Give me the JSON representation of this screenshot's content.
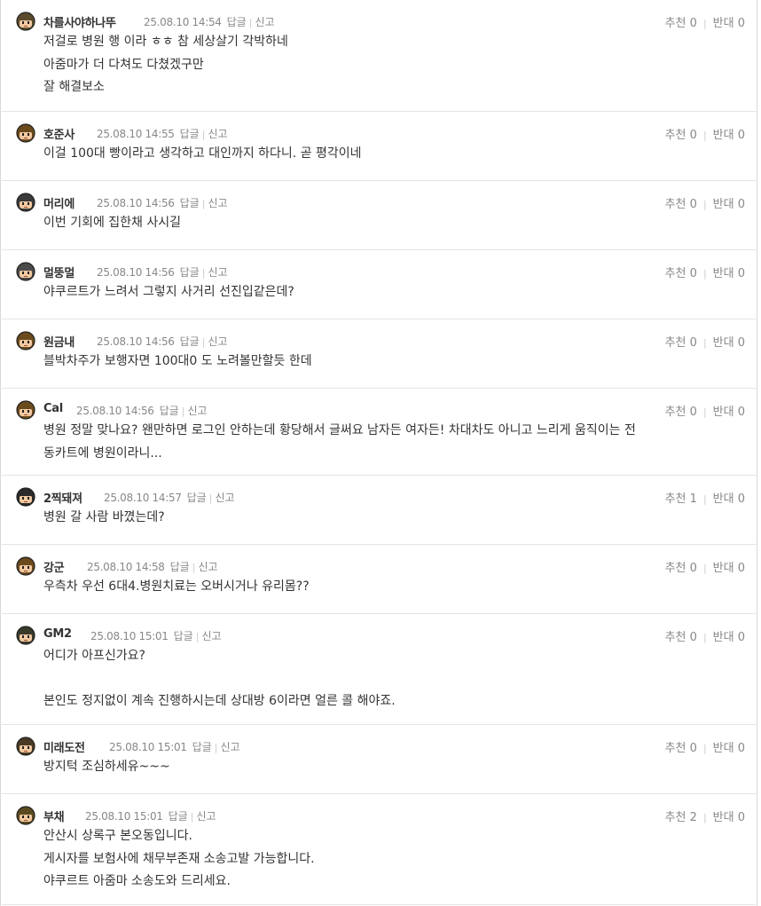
{
  "labels": {
    "reply": "답글",
    "report": "신고",
    "upvote": "추천",
    "downvote": "반대"
  },
  "comments": [
    {
      "nick": "차를사야하나뚜",
      "date": "25.08.10 14:54",
      "up": "0",
      "down": "0",
      "lines": [
        "저걸로 병원 행 이라 ㅎㅎ 참 세상살기 각박하네",
        "아줌마가 더 다쳐도 다쳤겠구만",
        "잘 해결보소"
      ]
    },
    {
      "nick": "호준사",
      "date": "25.08.10 14:55",
      "up": "0",
      "down": "0",
      "lines": [
        "이걸 100대 빵이라고 생각하고 대인까지 하다니. 곧 평각이네"
      ]
    },
    {
      "nick": "머리에",
      "date": "25.08.10 14:56",
      "up": "0",
      "down": "0",
      "lines": [
        "이번 기회에 집한채 사시길"
      ]
    },
    {
      "nick": "멀뚱멀",
      "date": "25.08.10 14:56",
      "up": "0",
      "down": "0",
      "lines": [
        "야쿠르트가 느려서 그렇지 사거리 선진입같은데?"
      ]
    },
    {
      "nick": "원금내",
      "date": "25.08.10 14:56",
      "up": "0",
      "down": "0",
      "lines": [
        "블박차주가 보행자면 100대0 도 노려볼만할듯 한데"
      ]
    },
    {
      "nick": "Cal",
      "date": "25.08.10 14:56",
      "up": "0",
      "down": "0",
      "lines": [
        "병원 정말 맞나요? 왠만하면 로그인 안하는데 황당해서 글써요 남자든 여자든! 차대차도 아니고 느리게 움직이는 전",
        "동카트에 병원이라니..."
      ]
    },
    {
      "nick": "2찍돼져",
      "date": "25.08.10 14:57",
      "up": "1",
      "down": "0",
      "lines": [
        "병원 갈 사람 바꼈는데?"
      ]
    },
    {
      "nick": "강군",
      "date": "25.08.10 14:58",
      "up": "0",
      "down": "0",
      "lines": [
        "우측차 우선 6대4.병원치료는 오버시거나 유리몸??"
      ]
    },
    {
      "nick": "GM2",
      "date": "25.08.10 15:01",
      "up": "0",
      "down": "0",
      "lines": [
        "어디가 아프신가요?",
        "",
        "본인도 정지없이 계속 진행하시는데 상대방 6이라면 얼른 콜 해야죠."
      ]
    },
    {
      "nick": "미래도전",
      "date": "25.08.10 15:01",
      "up": "0",
      "down": "0",
      "lines": [
        "방지턱 조심하세유~~~"
      ]
    },
    {
      "nick": "부채",
      "date": "25.08.10 15:01",
      "up": "2",
      "down": "0",
      "lines": [
        "안산시 상록구 본오동입니다.",
        "게시자를 보험사에 채무부존재 소송고발 가능합니다.",
        "야쿠르트 아줌마 소송도와 드리세요."
      ]
    }
  ]
}
